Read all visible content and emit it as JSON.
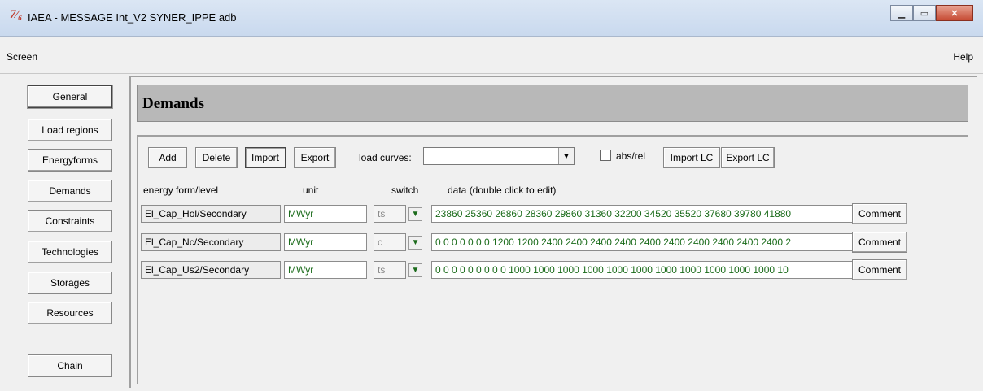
{
  "window": {
    "title": "IAEA - MESSAGE Int_V2 SYNER_IPPE adb",
    "app_icon": "message-logo",
    "controls": [
      "minimize-icon",
      "maximize-icon",
      "close-icon"
    ]
  },
  "menubar": {
    "screen": "Screen",
    "help": "Help"
  },
  "nav": {
    "general": "General",
    "load_regions": "Load regions",
    "energyforms": "Energyforms",
    "demands": "Demands",
    "constraints": "Constraints",
    "technologies": "Technologies",
    "storages": "Storages",
    "resources": "Resources",
    "chain": "Chain"
  },
  "page": {
    "title": "Demands"
  },
  "toolbar": {
    "add": "Add",
    "delete": "Delete",
    "import": "Import",
    "export": "Export",
    "load_curves_label": "load curves:",
    "load_curves_value": "",
    "abs_rel_label": "abs/rel",
    "abs_rel_checked": false,
    "import_lc": "Import LC",
    "export_lc": "Export LC"
  },
  "table": {
    "headers": {
      "name": "energy form/level",
      "unit": "unit",
      "switch": "switch",
      "data": "data (double click to edit)"
    },
    "rows": [
      {
        "name": "El_Cap_Hol/Secondary",
        "unit": "MWyr",
        "switch": "ts",
        "data": "23860 25360 26860 28360 29860 31360 32200 34520 35520 37680 39780 41880",
        "comment": "Comment"
      },
      {
        "name": "El_Cap_Nc/Secondary",
        "unit": "MWyr",
        "switch": "c",
        "data": "0 0 0 0 0 0 0 1200 1200 2400 2400 2400 2400 2400 2400 2400 2400 2400 2400 2",
        "comment": "Comment"
      },
      {
        "name": "El_Cap_Us2/Secondary",
        "unit": "MWyr",
        "switch": "ts",
        "data": "0 0 0 0 0 0 0 0 0 1000 1000 1000 1000 1000 1000 1000 1000 1000 1000 1000 10",
        "comment": "Comment"
      }
    ]
  },
  "colors": {
    "data_text": "#1a6b1a",
    "header_bar": "#b8b8b8"
  }
}
